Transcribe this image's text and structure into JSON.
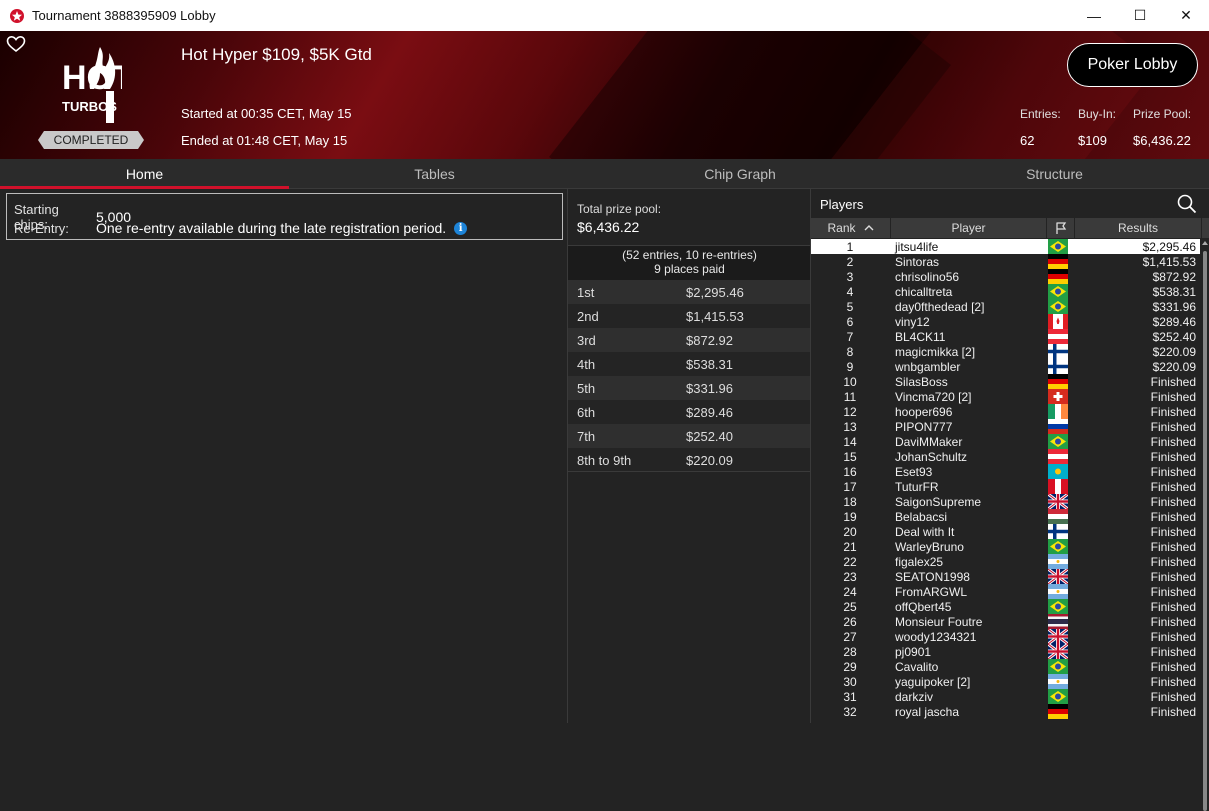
{
  "window": {
    "title": "Tournament 3888395909 Lobby",
    "controls": {
      "minimize": "—",
      "maximize": "☐",
      "close": "✕"
    }
  },
  "header": {
    "logo_top": "HOT",
    "logo_bottom": "TURBOS",
    "status": "COMPLETED",
    "name": "Hot Hyper $109, $5K Gtd",
    "started": "Started at 00:35 CET, May 15",
    "ended": "Ended at 01:48 CET, May 15",
    "lobby_button": "Poker Lobby",
    "stats": {
      "entries_label": "Entries:",
      "entries": "62",
      "buyin_label": "Buy-In:",
      "buyin": "$109",
      "prize_label": "Prize Pool:",
      "prize": "$6,436.22"
    },
    "colors": {
      "brand_red": "#d0112b"
    }
  },
  "tabs": [
    {
      "label": "Home",
      "active": true
    },
    {
      "label": "Tables",
      "active": false
    },
    {
      "label": "Chip Graph",
      "active": false
    },
    {
      "label": "Structure",
      "active": false
    }
  ],
  "home": {
    "starting_chips_label": "Starting chips:",
    "starting_chips": "5,000",
    "reentry_label": "Re-Entry:",
    "reentry": "One re-entry available during the late registration period.",
    "info_icon": "i"
  },
  "prize": {
    "total_label": "Total prize pool:",
    "total": "$6,436.22",
    "entries_line": "(52 entries, 10 re-entries)",
    "paid_line": "9 places paid",
    "rows": [
      {
        "place": "1st",
        "amount": "$2,295.46"
      },
      {
        "place": "2nd",
        "amount": "$1,415.53"
      },
      {
        "place": "3rd",
        "amount": "$872.92"
      },
      {
        "place": "4th",
        "amount": "$538.31"
      },
      {
        "place": "5th",
        "amount": "$331.96"
      },
      {
        "place": "6th",
        "amount": "$289.46"
      },
      {
        "place": "7th",
        "amount": "$252.40"
      },
      {
        "place": "8th to 9th",
        "amount": "$220.09"
      }
    ]
  },
  "players": {
    "title": "Players",
    "columns": {
      "rank": "Rank",
      "player": "Player",
      "results": "Results"
    },
    "rows": [
      {
        "rank": "1",
        "name": "jitsu4life",
        "flag": "BR",
        "result": "$2,295.46"
      },
      {
        "rank": "2",
        "name": "Sintoras",
        "flag": "DE",
        "result": "$1,415.53"
      },
      {
        "rank": "3",
        "name": "chrisolino56",
        "flag": "DE",
        "result": "$872.92"
      },
      {
        "rank": "4",
        "name": "chicalltreta",
        "flag": "BR",
        "result": "$538.31"
      },
      {
        "rank": "5",
        "name": "day0fthedead [2]",
        "flag": "BR",
        "result": "$331.96"
      },
      {
        "rank": "6",
        "name": "viny12",
        "flag": "CA",
        "result": "$289.46"
      },
      {
        "rank": "7",
        "name": "BL4CK11",
        "flag": "AT",
        "result": "$252.40"
      },
      {
        "rank": "8",
        "name": "magicmikka [2]",
        "flag": "FI",
        "result": "$220.09"
      },
      {
        "rank": "9",
        "name": "wnbgambler",
        "flag": "FI",
        "result": "$220.09"
      },
      {
        "rank": "10",
        "name": "SilasBoss",
        "flag": "DE",
        "result": "Finished"
      },
      {
        "rank": "11",
        "name": "Vincma720 [2]",
        "flag": "CH",
        "result": "Finished"
      },
      {
        "rank": "12",
        "name": "hooper696",
        "flag": "IE",
        "result": "Finished"
      },
      {
        "rank": "13",
        "name": "PIPON777",
        "flag": "RU",
        "result": "Finished"
      },
      {
        "rank": "14",
        "name": "DaviMMaker",
        "flag": "BR",
        "result": "Finished"
      },
      {
        "rank": "15",
        "name": "JohanSchultz",
        "flag": "AT",
        "result": "Finished"
      },
      {
        "rank": "16",
        "name": "Eset93",
        "flag": "KZ",
        "result": "Finished"
      },
      {
        "rank": "17",
        "name": "TuturFR",
        "flag": "PE",
        "result": "Finished"
      },
      {
        "rank": "18",
        "name": "SaigonSupreme",
        "flag": "GB",
        "result": "Finished"
      },
      {
        "rank": "19",
        "name": "Belabacsi",
        "flag": "HU",
        "result": "Finished"
      },
      {
        "rank": "20",
        "name": "Deal with It",
        "flag": "FI",
        "result": "Finished"
      },
      {
        "rank": "21",
        "name": "WarleyBruno",
        "flag": "BR",
        "result": "Finished"
      },
      {
        "rank": "22",
        "name": "figalex25",
        "flag": "AR",
        "result": "Finished"
      },
      {
        "rank": "23",
        "name": "SEATON1998",
        "flag": "GB",
        "result": "Finished"
      },
      {
        "rank": "24",
        "name": "FromARGWL",
        "flag": "AR",
        "result": "Finished"
      },
      {
        "rank": "25",
        "name": "offQbert45",
        "flag": "BR",
        "result": "Finished"
      },
      {
        "rank": "26",
        "name": "Monsieur Foutre",
        "flag": "TH",
        "result": "Finished"
      },
      {
        "rank": "27",
        "name": "woody1234321",
        "flag": "GB",
        "result": "Finished"
      },
      {
        "rank": "28",
        "name": "pj0901",
        "flag": "GB",
        "result": "Finished"
      },
      {
        "rank": "29",
        "name": "Cavalito",
        "flag": "BR",
        "result": "Finished"
      },
      {
        "rank": "30",
        "name": "yaguipoker [2]",
        "flag": "AR",
        "result": "Finished"
      },
      {
        "rank": "31",
        "name": "darkziv",
        "flag": "BR",
        "result": "Finished"
      },
      {
        "rank": "32",
        "name": "royal jascha",
        "flag": "DE",
        "result": "Finished"
      }
    ]
  }
}
